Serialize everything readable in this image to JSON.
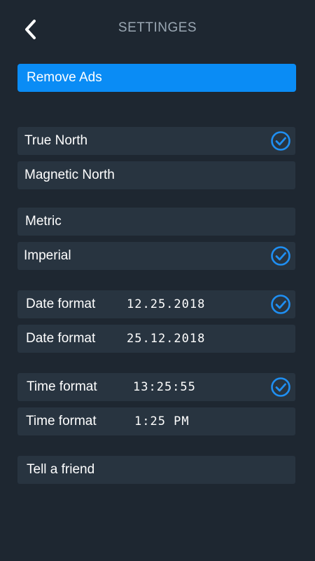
{
  "header": {
    "title": "SETTINGES"
  },
  "remove_ads": {
    "label": "Remove Ads"
  },
  "north": {
    "true_north": {
      "label": "True North",
      "selected": true
    },
    "magnetic_north": {
      "label": "Magnetic North",
      "selected": false
    }
  },
  "units": {
    "metric": {
      "label": "Metric",
      "selected": false
    },
    "imperial": {
      "label": "Imperial",
      "selected": true
    }
  },
  "date": {
    "mdy": {
      "label": "Date format",
      "value": "12.25.2018",
      "selected": true
    },
    "dmy": {
      "label": "Date format",
      "value": "25.12.2018",
      "selected": false
    }
  },
  "time": {
    "h24": {
      "label": "Time format",
      "value": "13:25:55",
      "selected": true
    },
    "h12": {
      "label": "Time format",
      "value": "1:25 PM",
      "selected": false
    }
  },
  "share": {
    "label": "Tell a friend"
  },
  "colors": {
    "background": "#1e2731",
    "row": "#283440",
    "accent": "#0a8cf5",
    "check": "#1f8ff2"
  },
  "icons": {
    "back": "chevron-left-icon",
    "check": "check-circle-icon"
  }
}
